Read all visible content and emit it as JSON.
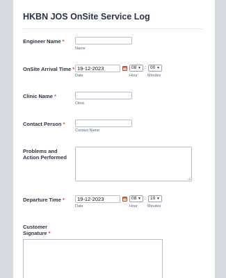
{
  "form": {
    "title": "HKBN JOS OnSite Service Log"
  },
  "fields": {
    "engineer_name": {
      "label": "Engineer Name",
      "required": "*",
      "sublabel": "Name",
      "value": ""
    },
    "arrival": {
      "label": "OnSite Arrival Time",
      "required": "*",
      "date_value": "19-12-2023",
      "date_sub": "Date",
      "hour_value": "08",
      "hour_sub": "Hour",
      "minute_value": "00",
      "minute_sub": "Minutes",
      "separator": ":"
    },
    "clinic_name": {
      "label": "Clinic Name",
      "required": "*",
      "sublabel": "Clinic",
      "value": ""
    },
    "contact_person": {
      "label": "Contact Person",
      "required": "*",
      "sublabel": "Contact Name",
      "value": ""
    },
    "problems": {
      "label": "Problems and Action Performed",
      "value": ""
    },
    "departure": {
      "label": "Departure Time",
      "required": "*",
      "date_value": "19-12-2023",
      "date_sub": "Date",
      "hour_value": "08",
      "hour_sub": "Hour",
      "minute_value": "10",
      "minute_sub": "Minutes",
      "separator": ":"
    },
    "signature": {
      "label": "Customer Signature",
      "required": "*"
    }
  },
  "icons": {
    "calendar": "calendar-icon",
    "dropdown": "chevron-down-icon"
  },
  "colors": {
    "page_bg": "#d7dbe0",
    "card_bg": "#ffffff",
    "text": "#2c3345",
    "required": "#e0383e",
    "calendar_accent": "#e07a3c"
  }
}
